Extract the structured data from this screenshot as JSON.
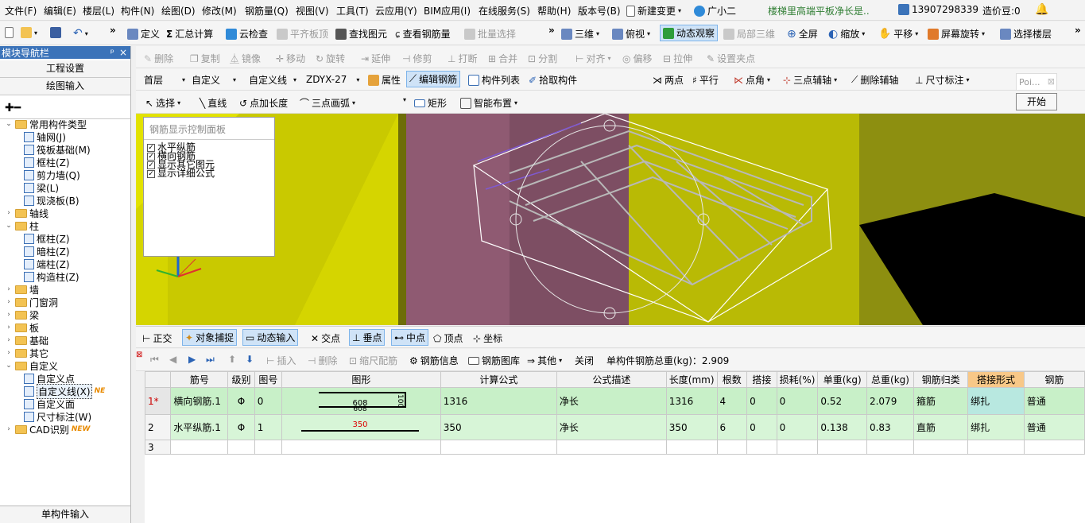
{
  "menu": {
    "items": [
      "文件(F)",
      "编辑(E)",
      "楼层(L)",
      "构件(N)",
      "绘图(D)",
      "修改(M)",
      "钢筋量(Q)",
      "视图(V)",
      "工具(T)",
      "云应用(Y)",
      "BIM应用(I)",
      "在线服务(S)",
      "帮助(H)",
      "版本号(B)"
    ],
    "new_change": "新建变更",
    "assistant": "广小二",
    "notice": "楼梯里高端平板净长是..",
    "phone": "13907298339",
    "coins": "造价豆:0"
  },
  "toolbar1": {
    "define": "定义",
    "sum_calc": "汇总计算",
    "cloud_check": "云检查",
    "flat_slab_top": "平齐板顶",
    "find_element": "查找图元",
    "view_rebar": "查看钢筋量",
    "batch_select": "批量选择",
    "view_3d": "三维",
    "top_view": "俯视",
    "dynamic_view": "动态观察",
    "local_3d": "局部三维",
    "fullscreen": "全屏",
    "zoom": "缩放",
    "pan": "平移",
    "screen_rotate": "屏幕旋转",
    "select_floor": "选择楼层"
  },
  "toolbar2": {
    "delete": "删除",
    "copy": "复制",
    "mirror": "镜像",
    "move": "移动",
    "rotate": "旋转",
    "extend": "延伸",
    "trim": "修剪",
    "break": "打断",
    "merge": "合并",
    "split": "分割",
    "align": "对齐",
    "offset": "偏移",
    "stretch": "拉伸",
    "set_clamp": "设置夹点"
  },
  "toolbar3": {
    "floor": "首层",
    "category": "自定义",
    "sub_category": "自定义线",
    "element": "ZDYX-27",
    "properties": "属性",
    "edit_rebar": "编辑钢筋",
    "element_list": "构件列表",
    "pick_element": "拾取构件",
    "two_points": "两点",
    "parallel": "平行",
    "point_angle": "点角",
    "three_point_axis": "三点辅轴",
    "delete_axis": "删除辅轴",
    "dimension": "尺寸标注"
  },
  "toolbar4": {
    "select": "选择",
    "line": "直线",
    "point_length": "点加长度",
    "three_point_arc": "三点画弧",
    "rect": "矩形",
    "smart_layout": "智能布置"
  },
  "float_window": {
    "title": "Poi...",
    "start": "开始"
  },
  "left_panel": {
    "title": "模块导航栏",
    "pin": "ᵖ",
    "close": "×",
    "project_settings": "工程设置",
    "drawing_input": "绘图输入",
    "single_input": "单构件输入",
    "tree": [
      {
        "label": "常用构件类型",
        "level": 0,
        "expanded": true,
        "folder": true
      },
      {
        "label": "轴网(J)",
        "level": 1
      },
      {
        "label": "筏板基础(M)",
        "level": 1
      },
      {
        "label": "框柱(Z)",
        "level": 1
      },
      {
        "label": "剪力墙(Q)",
        "level": 1
      },
      {
        "label": "梁(L)",
        "level": 1
      },
      {
        "label": "现浇板(B)",
        "level": 1
      },
      {
        "label": "轴线",
        "level": 0,
        "expanded": false,
        "folder": true
      },
      {
        "label": "柱",
        "level": 0,
        "expanded": true,
        "folder": true
      },
      {
        "label": "框柱(Z)",
        "level": 1
      },
      {
        "label": "暗柱(Z)",
        "level": 1
      },
      {
        "label": "端柱(Z)",
        "level": 1
      },
      {
        "label": "构造柱(Z)",
        "level": 1
      },
      {
        "label": "墙",
        "level": 0,
        "expanded": false,
        "folder": true
      },
      {
        "label": "门窗洞",
        "level": 0,
        "expanded": false,
        "folder": true
      },
      {
        "label": "梁",
        "level": 0,
        "expanded": false,
        "folder": true
      },
      {
        "label": "板",
        "level": 0,
        "expanded": false,
        "folder": true
      },
      {
        "label": "基础",
        "level": 0,
        "expanded": false,
        "folder": true
      },
      {
        "label": "其它",
        "level": 0,
        "expanded": false,
        "folder": true
      },
      {
        "label": "自定义",
        "level": 0,
        "expanded": true,
        "folder": true
      },
      {
        "label": "自定义点",
        "level": 1
      },
      {
        "label": "自定义线(X)",
        "level": 1,
        "selected": true,
        "tag": "NE"
      },
      {
        "label": "自定义面",
        "level": 1
      },
      {
        "label": "尺寸标注(W)",
        "level": 1
      },
      {
        "label": "CAD识别",
        "level": 0,
        "expanded": false,
        "folder": true,
        "tag": "NEW"
      }
    ]
  },
  "rebar_panel": {
    "title": "钢筋显示控制面板",
    "options": [
      {
        "label": "水平纵筋",
        "checked": true
      },
      {
        "label": "横向钢筋",
        "checked": true
      },
      {
        "label": "显示其它图元",
        "checked": true
      },
      {
        "label": "显示详细公式",
        "checked": true
      }
    ]
  },
  "snap_bar": {
    "ortho": "正交",
    "object_snap": "对象捕捉",
    "dynamic_input": "动态输入",
    "intersection": "交点",
    "perpendicular": "垂点",
    "midpoint": "中点",
    "vertex": "顶点",
    "coordinate": "坐标"
  },
  "grid_toolbar": {
    "insert": "插入",
    "delete": "删除",
    "scale_rebar": "缩尺配筋",
    "rebar_info": "钢筋信息",
    "rebar_library": "钢筋图库",
    "other": "其他",
    "close": "关闭",
    "total_weight": "单构件钢筋总重(kg)：2.909"
  },
  "grid": {
    "headers": [
      "",
      "筋号",
      "级别",
      "图号",
      "图形",
      "计算公式",
      "公式描述",
      "长度(mm)",
      "根数",
      "搭接",
      "损耗(%)",
      "单重(kg)",
      "总重(kg)",
      "钢筋归类",
      "搭接形式",
      "钢筋"
    ],
    "rows": [
      {
        "no": "1*",
        "name": "横向钢筋.1",
        "grade": "Φ",
        "fig_no": "0",
        "shape": {
          "a": "608",
          "b": "100",
          "c": "608"
        },
        "formula": "1316",
        "desc": "净长",
        "length": "1316",
        "count": "4",
        "lap": "0",
        "loss": "0",
        "unit_w": "0.52",
        "total_w": "2.079",
        "category": "箍筋",
        "lap_type": "绑扎",
        "type": "普通"
      },
      {
        "no": "2",
        "name": "水平纵筋.1",
        "grade": "Φ",
        "fig_no": "1",
        "shape": {
          "a": "350"
        },
        "formula": "350",
        "desc": "净长",
        "length": "350",
        "count": "6",
        "lap": "0",
        "loss": "0",
        "unit_w": "0.138",
        "total_w": "0.83",
        "category": "直筋",
        "lap_type": "绑扎",
        "type": "普通"
      },
      {
        "no": "3"
      }
    ]
  },
  "colors": {
    "viewport_olive": "#8d8f10",
    "column_purple": "#8f5a72",
    "wall_yellow": "#d8d800",
    "rebar_white": "#ffffff",
    "title_blue": "#3b73b9",
    "row_green": "#c8f0c8",
    "lap_header_orange": "#f8c888"
  }
}
